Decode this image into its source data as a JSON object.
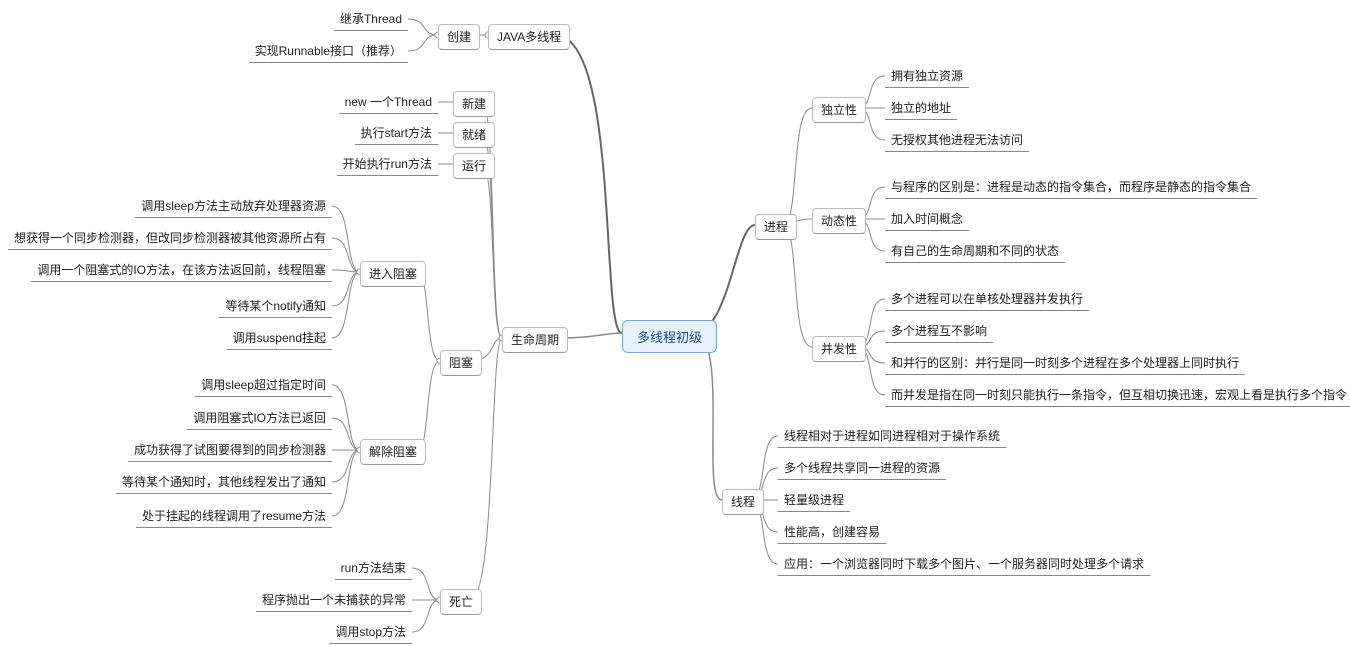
{
  "root": "多线程初级",
  "right": {
    "process": {
      "label": "进程",
      "independence": {
        "label": "独立性",
        "items": [
          "拥有独立资源",
          "独立的地址",
          "无授权其他进程无法访问"
        ]
      },
      "dynamism": {
        "label": "动态性",
        "items": [
          "与程序的区别是：进程是动态的指令集合，而程序是静态的指令集合",
          "加入时间概念",
          "有自己的生命周期和不同的状态"
        ]
      },
      "concurrency": {
        "label": "并发性",
        "items": [
          "多个进程可以在单核处理器并发执行",
          "多个进程互不影响",
          "和并行的区别：并行是同一时刻多个进程在多个处理器上同时执行",
          "而并发是指在同一时刻只能执行一条指令，但互相切换迅速，宏观上看是执行多个指令"
        ]
      }
    },
    "thread": {
      "label": "线程",
      "items": [
        "线程相对于进程如同进程相对于操作系统",
        "多个线程共享同一进程的资源",
        "轻量级进程",
        "性能高，创建容易",
        "应用：一个浏览器同时下载多个图片、一个服务器同时处理多个请求"
      ]
    }
  },
  "left": {
    "java": {
      "label": "JAVA多线程",
      "create": {
        "label": "创建",
        "items": [
          "继承Thread",
          "实现Runnable接口（推荐）"
        ]
      }
    },
    "lifecycle": {
      "label": "生命周期",
      "new": {
        "label": "新建",
        "leaf": "new 一个Thread"
      },
      "ready": {
        "label": "就绪",
        "leaf": "执行start方法"
      },
      "run": {
        "label": "运行",
        "leaf": "开始执行run方法"
      },
      "block": {
        "label": "阻塞",
        "enter": {
          "label": "进入阻塞",
          "items": [
            "调用sleep方法主动放弃处理器资源",
            "想获得一个同步检测器，但改同步检测器被其他资源所占有",
            "调用一个阻塞式的IO方法，在该方法返回前，线程阻塞",
            "等待某个notify通知",
            "调用suspend挂起"
          ]
        },
        "exit": {
          "label": "解除阻塞",
          "items": [
            "调用sleep超过指定时间",
            "调用阻塞式IO方法已返回",
            "成功获得了试图要得到的同步检测器",
            "等待某个通知时，其他线程发出了通知",
            "处于挂起的线程调用了resume方法"
          ]
        }
      },
      "dead": {
        "label": "死亡",
        "items": [
          "run方法结束",
          "程序抛出一个未捕获的异常",
          "调用stop方法"
        ]
      }
    }
  }
}
